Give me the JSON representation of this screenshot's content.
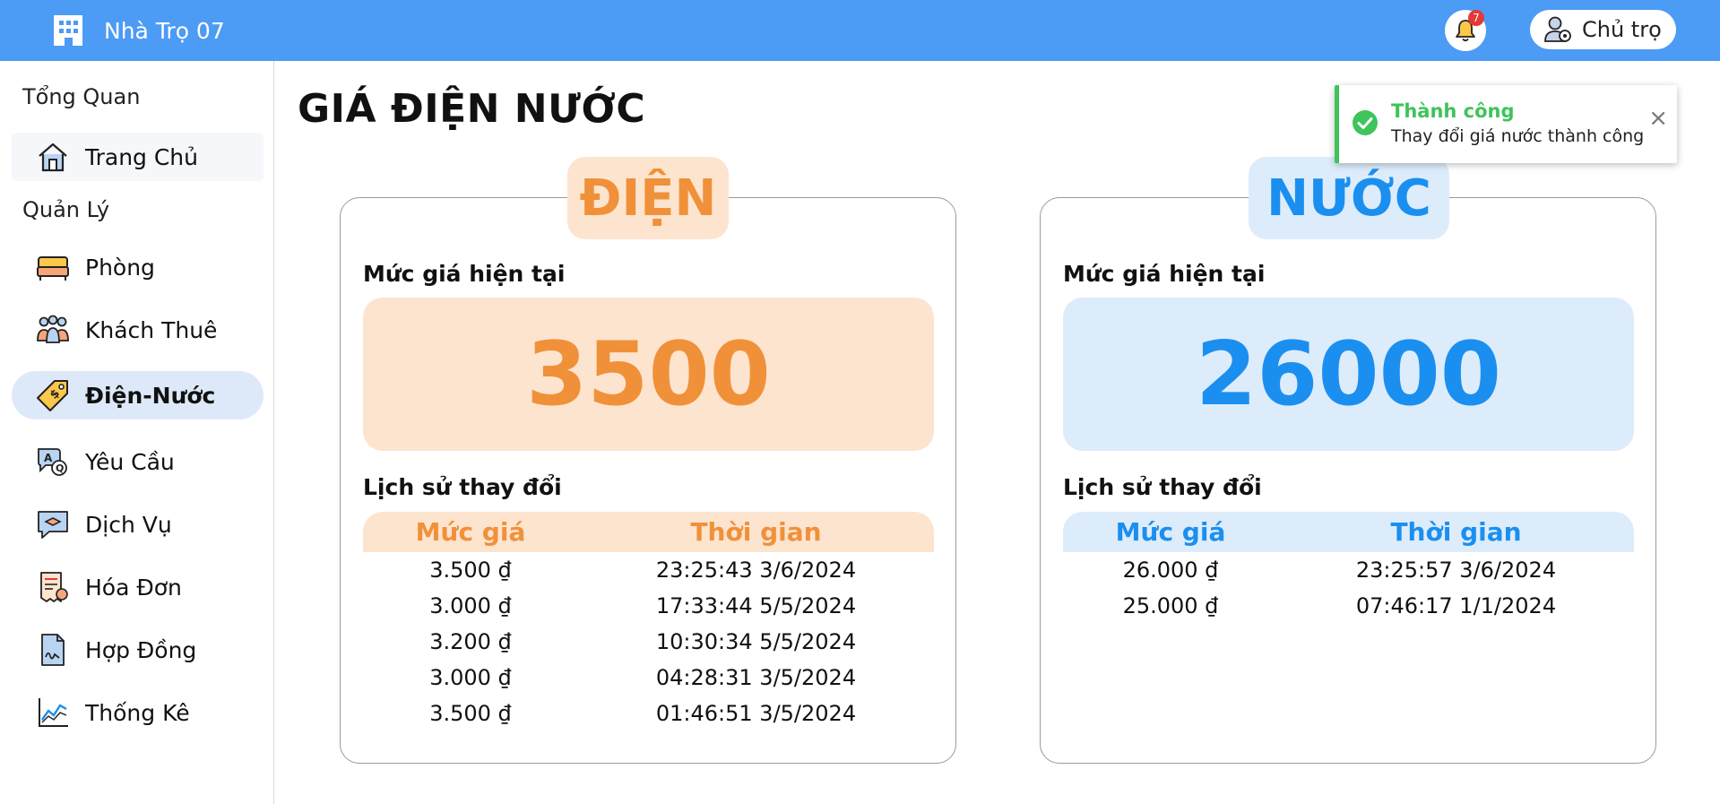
{
  "header": {
    "brand": "Nhà Trọ 07",
    "notification_count": "7",
    "user_label": "Chủ trọ"
  },
  "sidebar": {
    "section_overview": "Tổng Quan",
    "home": "Trang Chủ",
    "section_manage": "Quản Lý",
    "items": [
      {
        "label": "Phòng",
        "icon": "bed-icon"
      },
      {
        "label": "Khách Thuê",
        "icon": "tenants-icon"
      },
      {
        "label": "Điện-Nước",
        "icon": "price-tag-icon",
        "active": true
      },
      {
        "label": "Yêu Cầu",
        "icon": "request-chat-icon"
      },
      {
        "label": "Dịch Vụ",
        "icon": "service-icon"
      },
      {
        "label": "Hóa Đơn",
        "icon": "invoice-icon"
      },
      {
        "label": "Hợp Đồng",
        "icon": "contract-icon"
      },
      {
        "label": "Thống Kê",
        "icon": "chart-icon"
      }
    ]
  },
  "page": {
    "title": "GIÁ ĐIỆN NƯỚC"
  },
  "electric": {
    "tag": "ĐIỆN",
    "current_label": "Mức giá hiện tại",
    "current_price": "3500",
    "history_label": "Lịch sử thay đổi",
    "col_price": "Mức giá",
    "col_time": "Thời gian",
    "rows": [
      {
        "price": "3.500 ₫",
        "time": "23:25:43 3/6/2024"
      },
      {
        "price": "3.000 ₫",
        "time": "17:33:44 5/5/2024"
      },
      {
        "price": "3.200 ₫",
        "time": "10:30:34 5/5/2024"
      },
      {
        "price": "3.000 ₫",
        "time": "04:28:31 3/5/2024"
      },
      {
        "price": "3.500 ₫",
        "time": "01:46:51 3/5/2024"
      }
    ],
    "accent": "#f0913a",
    "bg": "#fde4cf"
  },
  "water": {
    "tag": "NƯỚC",
    "current_label": "Mức giá hiện tại",
    "current_price": "26000",
    "history_label": "Lịch sử thay đổi",
    "col_price": "Mức giá",
    "col_time": "Thời gian",
    "rows": [
      {
        "price": "26.000 ₫",
        "time": "23:25:57 3/6/2024"
      },
      {
        "price": "25.000 ₫",
        "time": "07:46:17 1/1/2024"
      }
    ],
    "accent": "#1b8ff0",
    "bg": "#ddecfb"
  },
  "toast": {
    "title": "Thành công",
    "message": "Thay đổi giá nước thành công",
    "close": "×",
    "accent": "#3ec45a"
  }
}
